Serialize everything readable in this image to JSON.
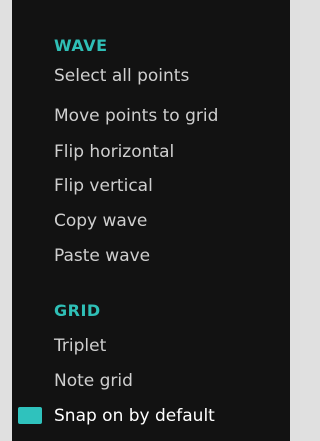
{
  "menu": {
    "wave": {
      "title": "WAVE",
      "items": [
        {
          "label": "Select all points"
        },
        {
          "label": "Move points to grid"
        },
        {
          "label": "Flip horizontal"
        },
        {
          "label": "Flip vertical"
        },
        {
          "label": "Copy wave"
        },
        {
          "label": "Paste wave"
        }
      ]
    },
    "grid": {
      "title": "GRID",
      "items": [
        {
          "label": "Triplet"
        },
        {
          "label": "Note grid"
        },
        {
          "label": "Snap on by default",
          "checked": true
        }
      ]
    }
  },
  "colors": {
    "accent": "#2fc2bd",
    "background": "#121212",
    "text": "#cfcfcf"
  }
}
